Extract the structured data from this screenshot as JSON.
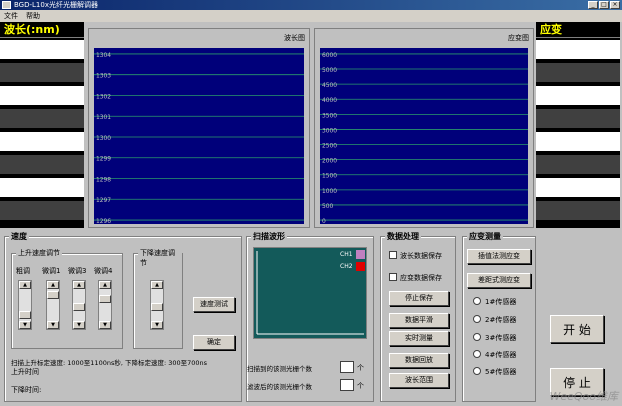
{
  "window": {
    "title": "BGD-L10x光纤光栅解调器"
  },
  "menu": {
    "items": [
      "文件",
      "帮助"
    ]
  },
  "left_panel": {
    "title": "波长(:nm)",
    "row_count": 9
  },
  "right_panel": {
    "title": "应变",
    "row_count": 9
  },
  "wave_chart": {
    "label": "波长图",
    "y_ticks": [
      "1304",
      "1303",
      "1302",
      "1301",
      "1300",
      "1299",
      "1298",
      "1297",
      "1296"
    ]
  },
  "strain_chart": {
    "label": "应变图",
    "y_ticks": [
      "6000",
      "5000",
      "4500",
      "4000",
      "3500",
      "3000",
      "2500",
      "2000",
      "1500",
      "1000",
      "500",
      "0"
    ]
  },
  "speed": {
    "title": "速度",
    "up_group": "上升速度调节",
    "sliders": [
      "粗调",
      "微调1",
      "微调3",
      "微调4"
    ],
    "down_group": "下降速度调节",
    "test_button": "速度测试",
    "confirm_button": "确定",
    "info_line1": "扫描上升标定速度: 1000至1100ns秒, 下降标定速度: 300至700ns",
    "up_time_label": "上升时间",
    "down_time_label": "下降时间:"
  },
  "scan": {
    "title": "扫描波形",
    "ch1": "CH1",
    "ch2": "CH2",
    "ch1_color": "#c080c0",
    "ch2_color": "#e00000",
    "count_before_label": "扫描到的该测光栅个数",
    "count_after_label": "滤波后的该测光栅个数",
    "unit": "个"
  },
  "data_proc": {
    "title": "数据处理",
    "check_wave": "波长数据保存",
    "check_strain": "应变数据保存",
    "buttons": [
      "停止保存",
      "数据平滑",
      "实时测量",
      "数据回放",
      "波长范围"
    ]
  },
  "strain_meas": {
    "title": "应变测量",
    "buttons": [
      "插值法测应变",
      "差距式测应变"
    ],
    "sensors": [
      "1#传感器",
      "2#传感器",
      "3#传感器",
      "4#传感器",
      "5#传感器"
    ]
  },
  "actions": {
    "start": "开 始",
    "stop": "停 止"
  },
  "watermark": "WeeQoo维库"
}
